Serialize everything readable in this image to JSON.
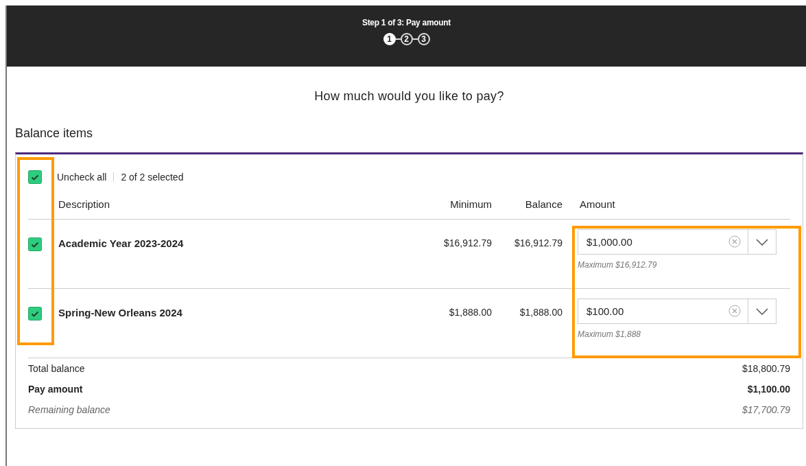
{
  "stepper": {
    "title": "Step 1 of 3: Pay amount",
    "steps": [
      {
        "label": "1",
        "selected": true
      },
      {
        "label": "2",
        "selected": false
      },
      {
        "label": "3",
        "selected": false
      }
    ]
  },
  "heading": "How much would you like to pay?",
  "section_title": "Balance items",
  "select_all": {
    "checked": true,
    "link": "Uncheck all",
    "count": "2 of 2 selected"
  },
  "table": {
    "columns": [
      "Description",
      "Minimum",
      "Balance",
      "Amount"
    ],
    "rows": [
      {
        "checked": true,
        "description": "Academic Year 2023-2024",
        "minimum": "$16,912.79",
        "balance": "$16,912.79",
        "amount": "$1,000.00",
        "hint": "Maximum $16,912.79"
      },
      {
        "checked": true,
        "description": "Spring-New Orleans 2024",
        "minimum": "$1,888.00",
        "balance": "$1,888.00",
        "amount": "$100.00",
        "hint": "Maximum $1,888"
      }
    ]
  },
  "summary": [
    {
      "kind": "plain",
      "label": "Total balance",
      "value": "$18,800.79"
    },
    {
      "kind": "strong",
      "label": "Pay amount",
      "value": "$1,100.00"
    },
    {
      "kind": "muted",
      "label": "Remaining balance",
      "value": "$17,700.79"
    }
  ],
  "highlights": {
    "checkbox_column": true,
    "amount_column": true
  }
}
